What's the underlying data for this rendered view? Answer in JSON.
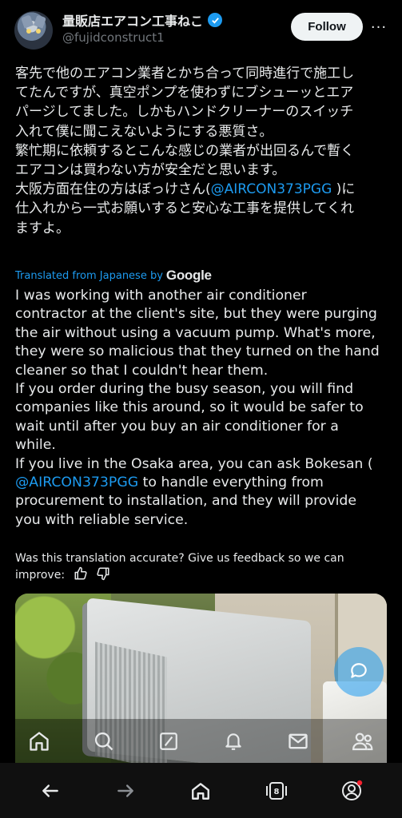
{
  "author": {
    "display_name": "量販店エアコン工事ねこ",
    "handle": "@fujidconstruct1",
    "follow_label": "Follow",
    "more_label": "···"
  },
  "post": {
    "jp_lines": [
      "客先で他のエアコン業者とかち合って同時進行で施工し",
      "てたんですが、真空ポンプを使わずにブシューッとエア",
      "パージしてました。しかもハンドクリーナーのスイッチ",
      "入れて僕に聞こえないようにする悪質さ。",
      "繁忙期に依頼するとこんな感じの業者が出回るんで暫く",
      "エアコンは買わない方が安全だと思います。"
    ],
    "jp_line7_before": "大阪方面在住の方はぼっけさん(",
    "jp_mention": "@AIRCON373PGG",
    "jp_line7_after": " )に",
    "jp_line8": "仕入れから一式お願いすると安心な工事を提供してくれ",
    "jp_line9": "ますよ。",
    "translated_label": "Translated from Japanese by",
    "translated_provider": "Google",
    "en_lines": [
      "I was working with another air conditioner",
      "contractor at the client's site, but they were purging",
      "the air without using a vacuum pump. What's more,",
      "they were so malicious that they turned on the hand",
      "cleaner so that I couldn't hear them.",
      "If you order during the busy season, you will find",
      "companies like this around, so it would be safer to",
      "wait until after you buy an air conditioner for a",
      "while.",
      "If you live in the Osaka area, you can ask Bokesan ("
    ],
    "en_mention": "@AIRCON373PGG",
    "en_line11_after": " to handle everything from",
    "en_line12": "procurement to installation, and they will provide",
    "en_line13": "you with reliable service.",
    "feedback_line1": "Was this translation accurate? Give us feedback so we can",
    "feedback_line2": "improve:"
  },
  "icons": {
    "thumbs_up": "thumbs-up-icon",
    "thumbs_down": "thumbs-down-icon",
    "compose": "reply-icon",
    "home": "home-icon",
    "search": "search-icon",
    "grok": "grok-icon",
    "notifications": "bell-icon",
    "messages": "mail-icon",
    "communities": "people-icon"
  },
  "system_nav": {
    "tabs_count": "8"
  },
  "colors": {
    "accent": "#1d9bf0",
    "background": "#000000",
    "follow_bg": "#eff3f4",
    "notification_dot": "#f4212e"
  }
}
